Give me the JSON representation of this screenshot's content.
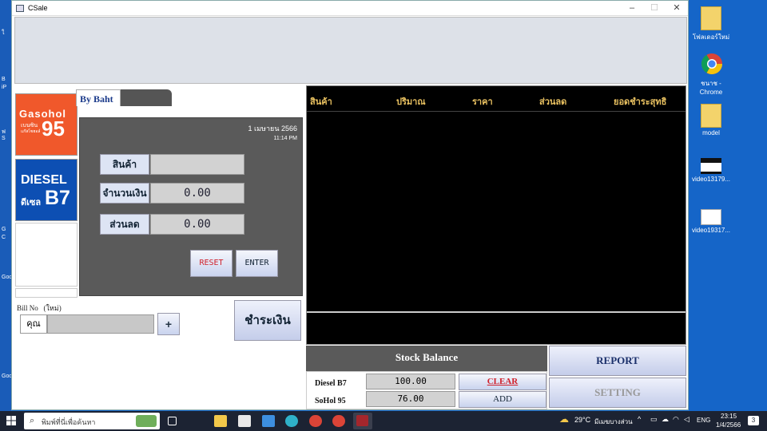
{
  "window": {
    "title": "CSale"
  },
  "desktop": {
    "icons": [
      {
        "label": "โฟลเดอร์ใหม่"
      },
      {
        "label": "ชนาช - Chrome"
      },
      {
        "label": "model"
      },
      {
        "label": "video13179..."
      },
      {
        "label": "video19317..."
      }
    ],
    "left_labels": [
      "ใ",
      "B",
      "iP",
      "ฟ",
      "S",
      "G",
      "C",
      "Goo",
      "Goo"
    ]
  },
  "fuels": {
    "gasohol": {
      "brand": "Gasohol",
      "sub": "เบนซิน",
      "sub2": "แก๊สโซฮอล์",
      "grade": "95"
    },
    "diesel": {
      "brand": "DIESEL",
      "sub": "ดีเซล",
      "grade": "B7"
    }
  },
  "tabs": {
    "by_baht": "By Baht"
  },
  "panel": {
    "date": "1 เมษายน 2566",
    "time": "11:14 PM",
    "product_label": "สินค้า",
    "amount_label": "จำนวนเงิน",
    "discount_label": "ส่วนลด",
    "product_value": "",
    "amount_value": "0.00",
    "discount_value": "0.00",
    "reset": "RESET",
    "enter": "ENTER"
  },
  "bill": {
    "label": "Bill No",
    "status": "(ใหม่)",
    "customer_prefix": "คุณ",
    "customer_value": "",
    "add": "+",
    "pay": "ชำระเงิน"
  },
  "grid": {
    "columns": [
      "สินค้า",
      "ปริมาณ",
      "ราคา",
      "ส่วนลด",
      "ยอดชำระสุทธิ"
    ]
  },
  "stock": {
    "title": "Stock Balance",
    "rows": [
      {
        "name": "Diesel B7",
        "value": "100.00",
        "action": "CLEAR"
      },
      {
        "name": "SoHol 95",
        "value": "76.00",
        "action": "ADD"
      }
    ]
  },
  "buttons": {
    "report": "REPORT",
    "setting": "SETTING"
  },
  "taskbar": {
    "search_placeholder": "พิมพ์ที่นี่เพื่อค้นหา",
    "weather": "29°C",
    "weather_desc": "มีเมฆบางส่วน",
    "lang": "ENG",
    "clock_time": "23:15",
    "clock_date": "1/4/2566",
    "notif_count": "3"
  }
}
